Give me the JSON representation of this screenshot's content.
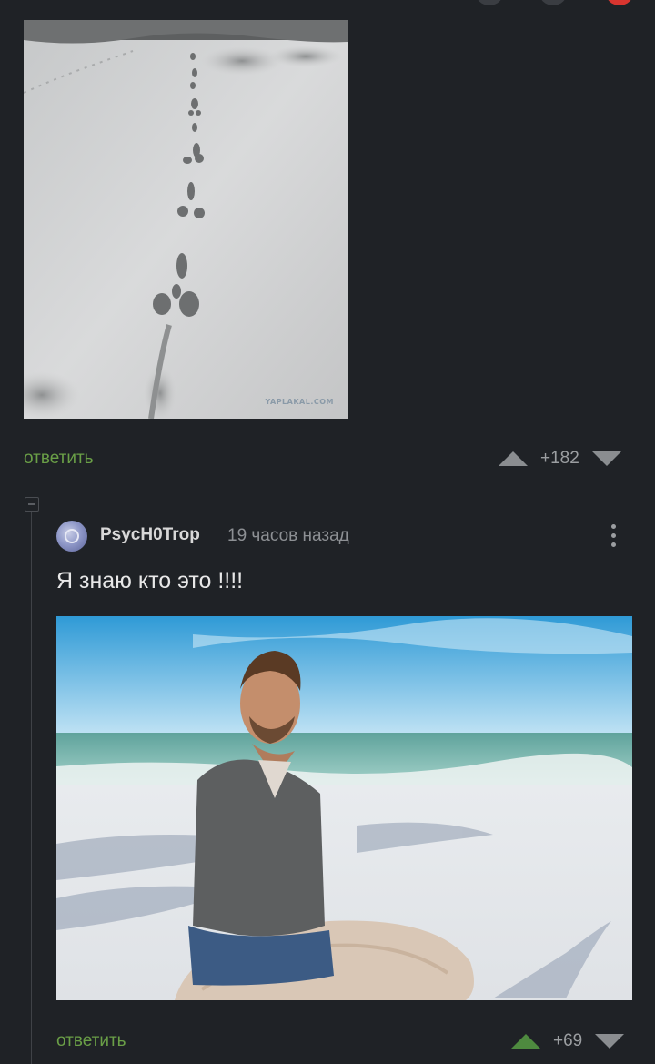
{
  "post": {
    "image_watermark": "YAPLAKAL.COM",
    "reply_label": "ответить",
    "score": "+182"
  },
  "comment": {
    "username": "PsycH0Trop",
    "timestamp": "19 часов назад",
    "text": "Я знаю кто это !!!!",
    "reply_label": "ответить",
    "score": "+69",
    "upvoted": true
  },
  "colors": {
    "background": "#1f2226",
    "reply_link": "#6a9f47",
    "upvote_active": "#4e8a3f",
    "vote_neutral": "#8a8d90"
  },
  "icons": {
    "upvote": "arrow-up-icon",
    "downvote": "arrow-down-icon",
    "more": "more-vertical-icon",
    "collapse": "collapse-minus-icon"
  }
}
